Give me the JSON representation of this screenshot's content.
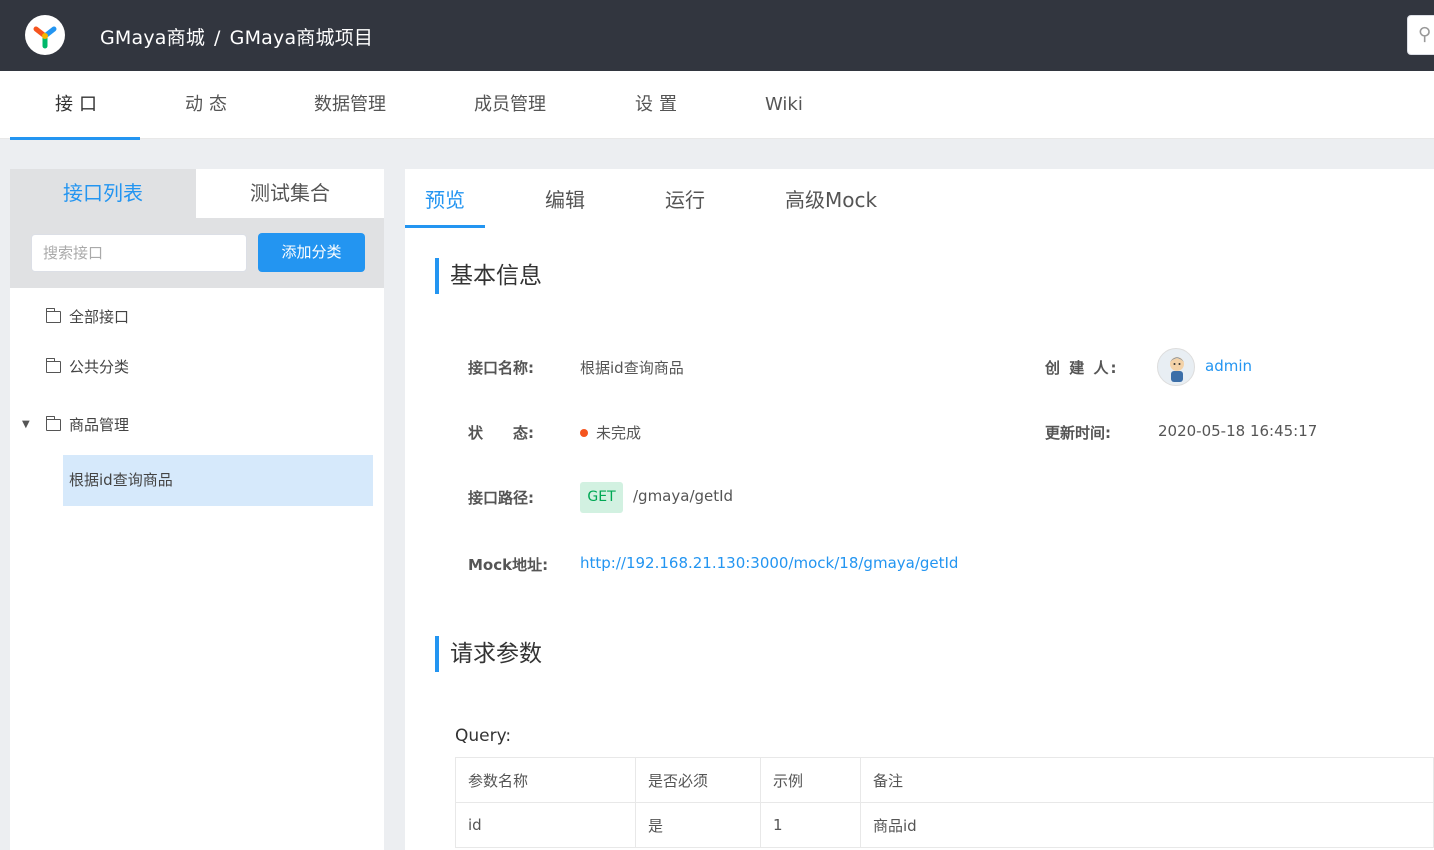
{
  "header": {
    "group": "GMaya商城",
    "separator": "/",
    "project": "GMaya商城项目"
  },
  "main_nav": {
    "tabs": [
      "接口",
      "动态",
      "数据管理",
      "成员管理",
      "设置",
      "Wiki"
    ],
    "active": "接口"
  },
  "sidebar": {
    "tabs": [
      "接口列表",
      "测试集合"
    ],
    "search_placeholder": "搜索接口",
    "add_button": "添加分类",
    "tree": [
      "全部接口",
      "公共分类",
      "商品管理"
    ],
    "selected_item": "根据id查询商品"
  },
  "detail": {
    "tabs": [
      "预览",
      "编辑",
      "运行",
      "高级Mock"
    ],
    "basic_title": "基本信息",
    "name_label": "接口名称:",
    "name_value": "根据id查询商品",
    "creator_label": "创 建 人:",
    "creator_value": "admin",
    "status_label": "状　　态:",
    "status_value": "未完成",
    "updated_label": "更新时间:",
    "updated_value": "2020-05-18 16:45:17",
    "path_label": "接口路径:",
    "method": "GET",
    "path_value": "/gmaya/getId",
    "mock_label": "Mock地址:",
    "mock_value": "http://192.168.21.130:3000/mock/18/gmaya/getId",
    "request_title": "请求参数",
    "query_label": "Query:",
    "table": {
      "headers": [
        "参数名称",
        "是否必须",
        "示例",
        "备注"
      ],
      "rows": [
        [
          "id",
          "是",
          "1",
          "商品id"
        ]
      ]
    }
  },
  "colors": {
    "accent": "#2395f1",
    "topbar": "#32363f",
    "status_dot": "#f5541e",
    "get_badge_bg": "#d2f1e1",
    "get_badge_text": "#00a854"
  }
}
